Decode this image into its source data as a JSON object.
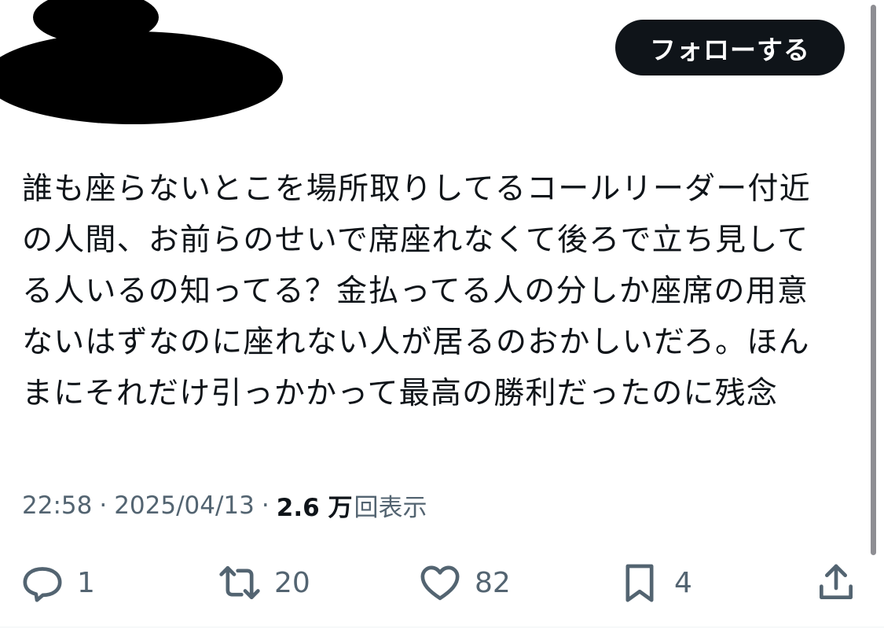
{
  "header": {
    "follow_label": "フォローする"
  },
  "tweet": {
    "text_lines": [
      "誰も座らないとこを場所取りしてるコールリーダー付近",
      "の人間、お前らのせいで席座れなくて後ろで立ち見して",
      "る人いるの知ってる？金払ってる人の分しか座席の用意",
      "ないはずなのに座れない人が居るのおかしいだろ。ほん",
      "まにそれだけ引っかかって最高の勝利だったのに残念"
    ]
  },
  "meta": {
    "time": "22:58",
    "separator": "·",
    "date": "2025/04/13",
    "views_count": "2.6 万",
    "views_label": "回表示"
  },
  "actions": {
    "reply": {
      "icon": "reply-icon",
      "count": "1"
    },
    "retweet": {
      "icon": "retweet-icon",
      "count": "20"
    },
    "like": {
      "icon": "heart-icon",
      "count": "82"
    },
    "bookmark": {
      "icon": "bookmark-icon",
      "count": "4"
    },
    "share": {
      "icon": "share-icon"
    }
  },
  "colors": {
    "text": "#0f1419",
    "secondary": "#536471",
    "button_bg": "#0f1419",
    "button_text": "#ffffff",
    "background": "#ffffff"
  }
}
